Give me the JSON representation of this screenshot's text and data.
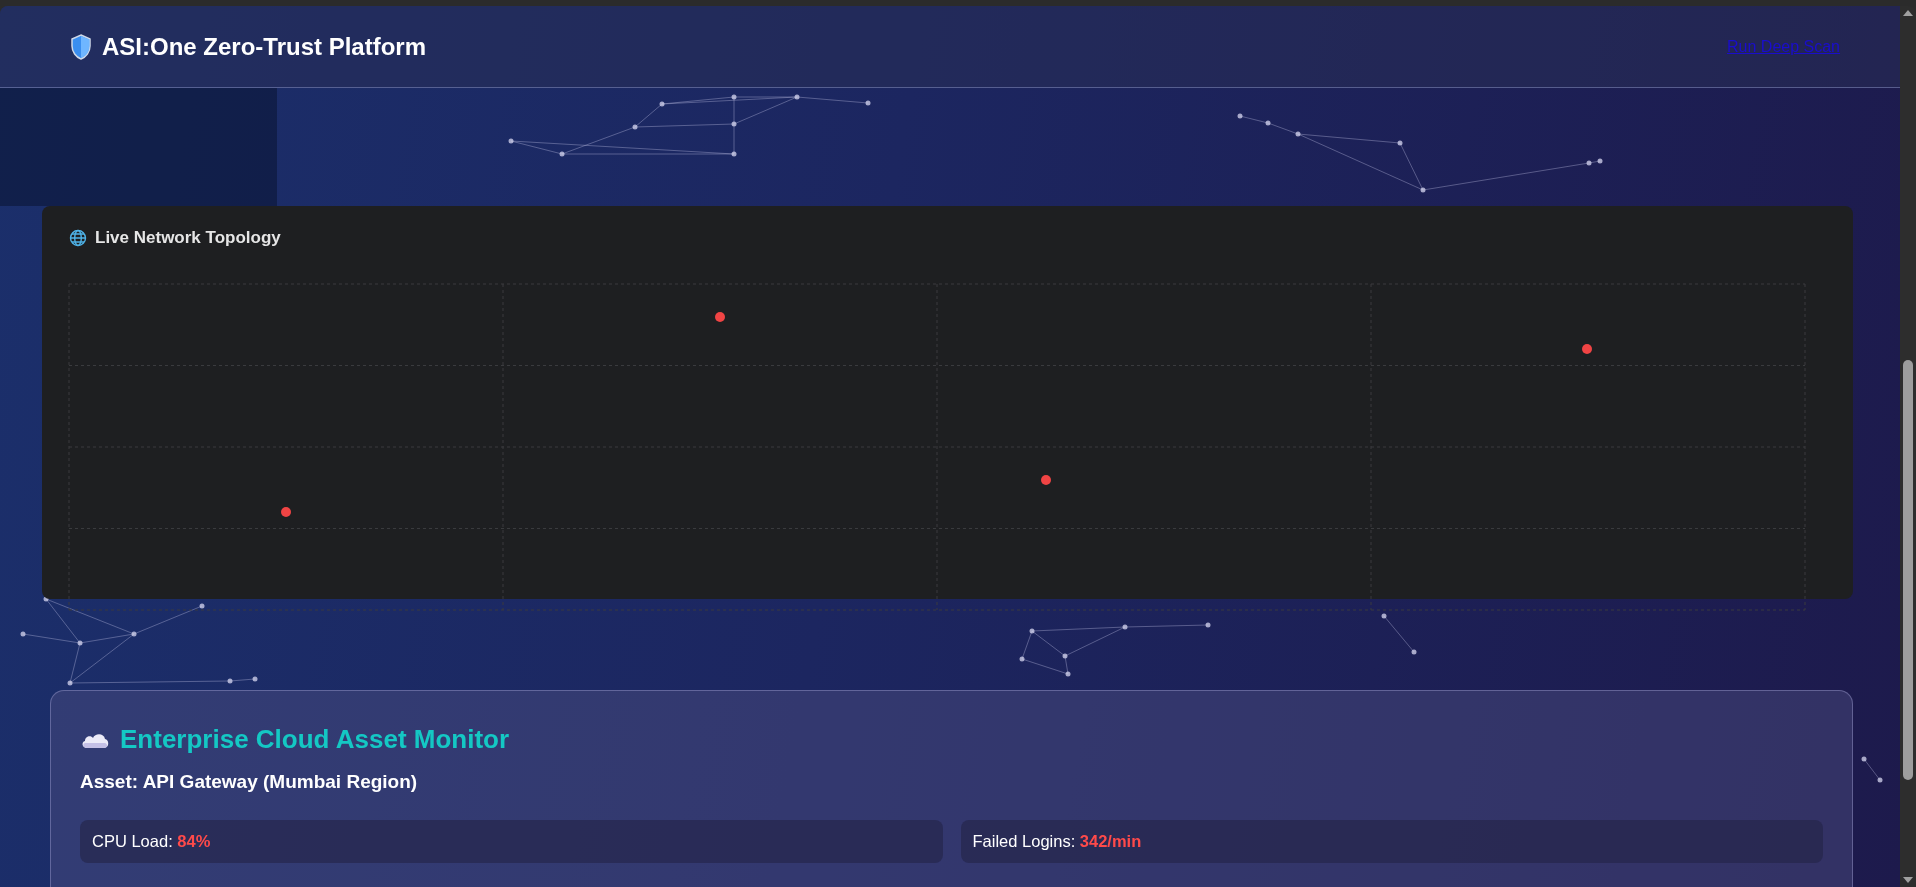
{
  "header": {
    "title": "ASI:One Zero-Trust Platform",
    "link": "Run Deep Scan"
  },
  "topology": {
    "title": "Live Network Topology"
  },
  "asset_monitor": {
    "title": "Enterprise Cloud Asset Monitor",
    "asset": "Asset: API Gateway (Mumbai Region)",
    "metrics": [
      {
        "label": "CPU Load:",
        "value": "84%"
      },
      {
        "label": "Failed Logins:",
        "value": "342/min"
      }
    ]
  }
}
